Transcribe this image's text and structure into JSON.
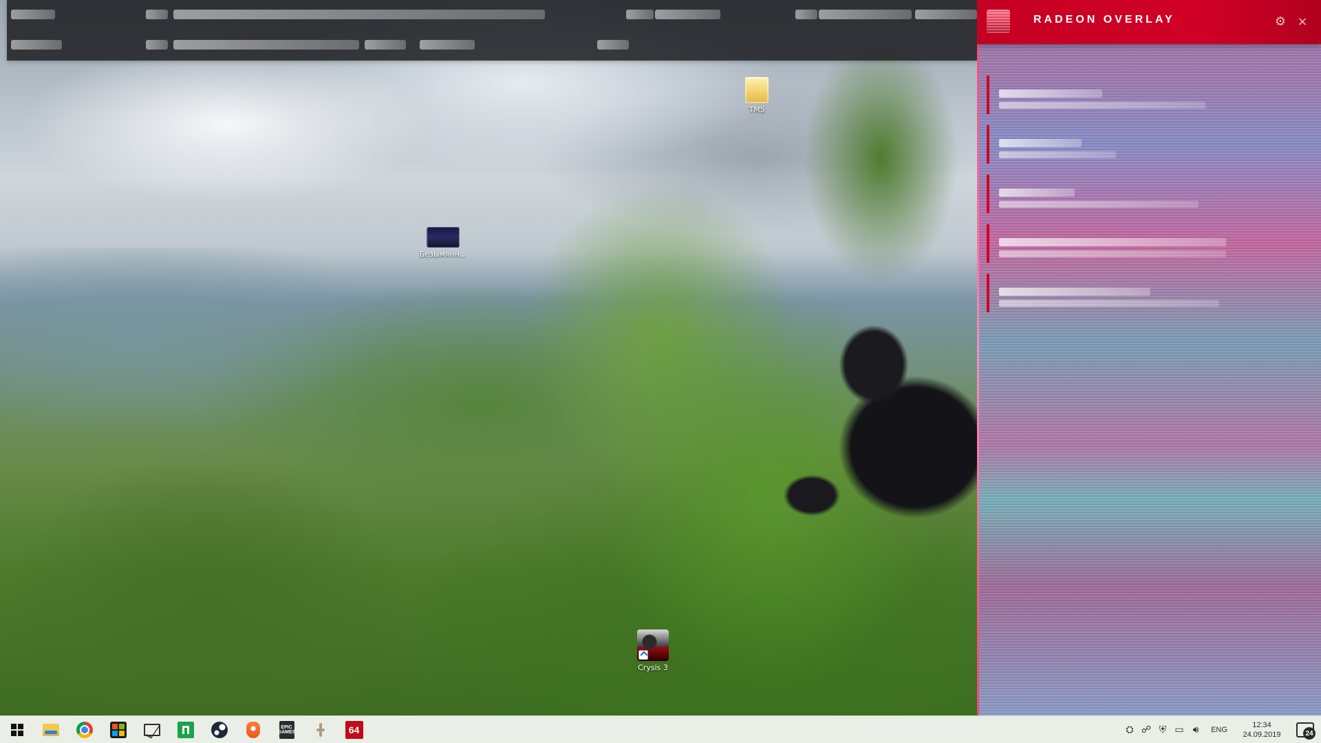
{
  "desktop": {
    "icons": [
      {
        "label": "TM5",
        "type": "folder"
      },
      {
        "label": "Безымянн...",
        "type": "image"
      },
      {
        "label": "Crysis 3",
        "type": "game-shortcut"
      }
    ]
  },
  "radeon_overlay": {
    "title": "RADEON OVERLAY",
    "header_logo": "radeon-logo",
    "settings_icon": "gear-icon",
    "close_icon": "close-icon"
  },
  "taskbar": {
    "pinned": [
      {
        "id": "start",
        "label": "Start",
        "icon": "windows-icon"
      },
      {
        "id": "explorer",
        "label": "File Explorer",
        "icon": "folder-icon"
      },
      {
        "id": "chrome",
        "label": "Google Chrome",
        "icon": "chrome-icon"
      },
      {
        "id": "store",
        "label": "Microsoft Store",
        "icon": "store-icon"
      },
      {
        "id": "mail",
        "label": "Mail",
        "icon": "mail-icon"
      },
      {
        "id": "green",
        "label": "Green App",
        "icon": "green-square-icon"
      },
      {
        "id": "steam",
        "label": "Steam",
        "icon": "steam-icon"
      },
      {
        "id": "origin",
        "label": "Origin",
        "icon": "origin-icon"
      },
      {
        "id": "epic",
        "label": "Epic Games",
        "icon": "epic-icon",
        "text": "EPIC\nGAMES"
      },
      {
        "id": "ubisoft",
        "label": "Ubisoft",
        "icon": "ubisoft-icon"
      },
      {
        "id": "aida64",
        "label": "AIDA64",
        "icon": "aida64-icon",
        "text": "64"
      }
    ],
    "tray": {
      "icons": [
        "settings-icon",
        "network-icon",
        "security-icon",
        "pc-icon",
        "volume-icon"
      ],
      "language": "ENG",
      "time": "12:34",
      "date": "24.09.2019",
      "notifications_badge": "24"
    }
  }
}
